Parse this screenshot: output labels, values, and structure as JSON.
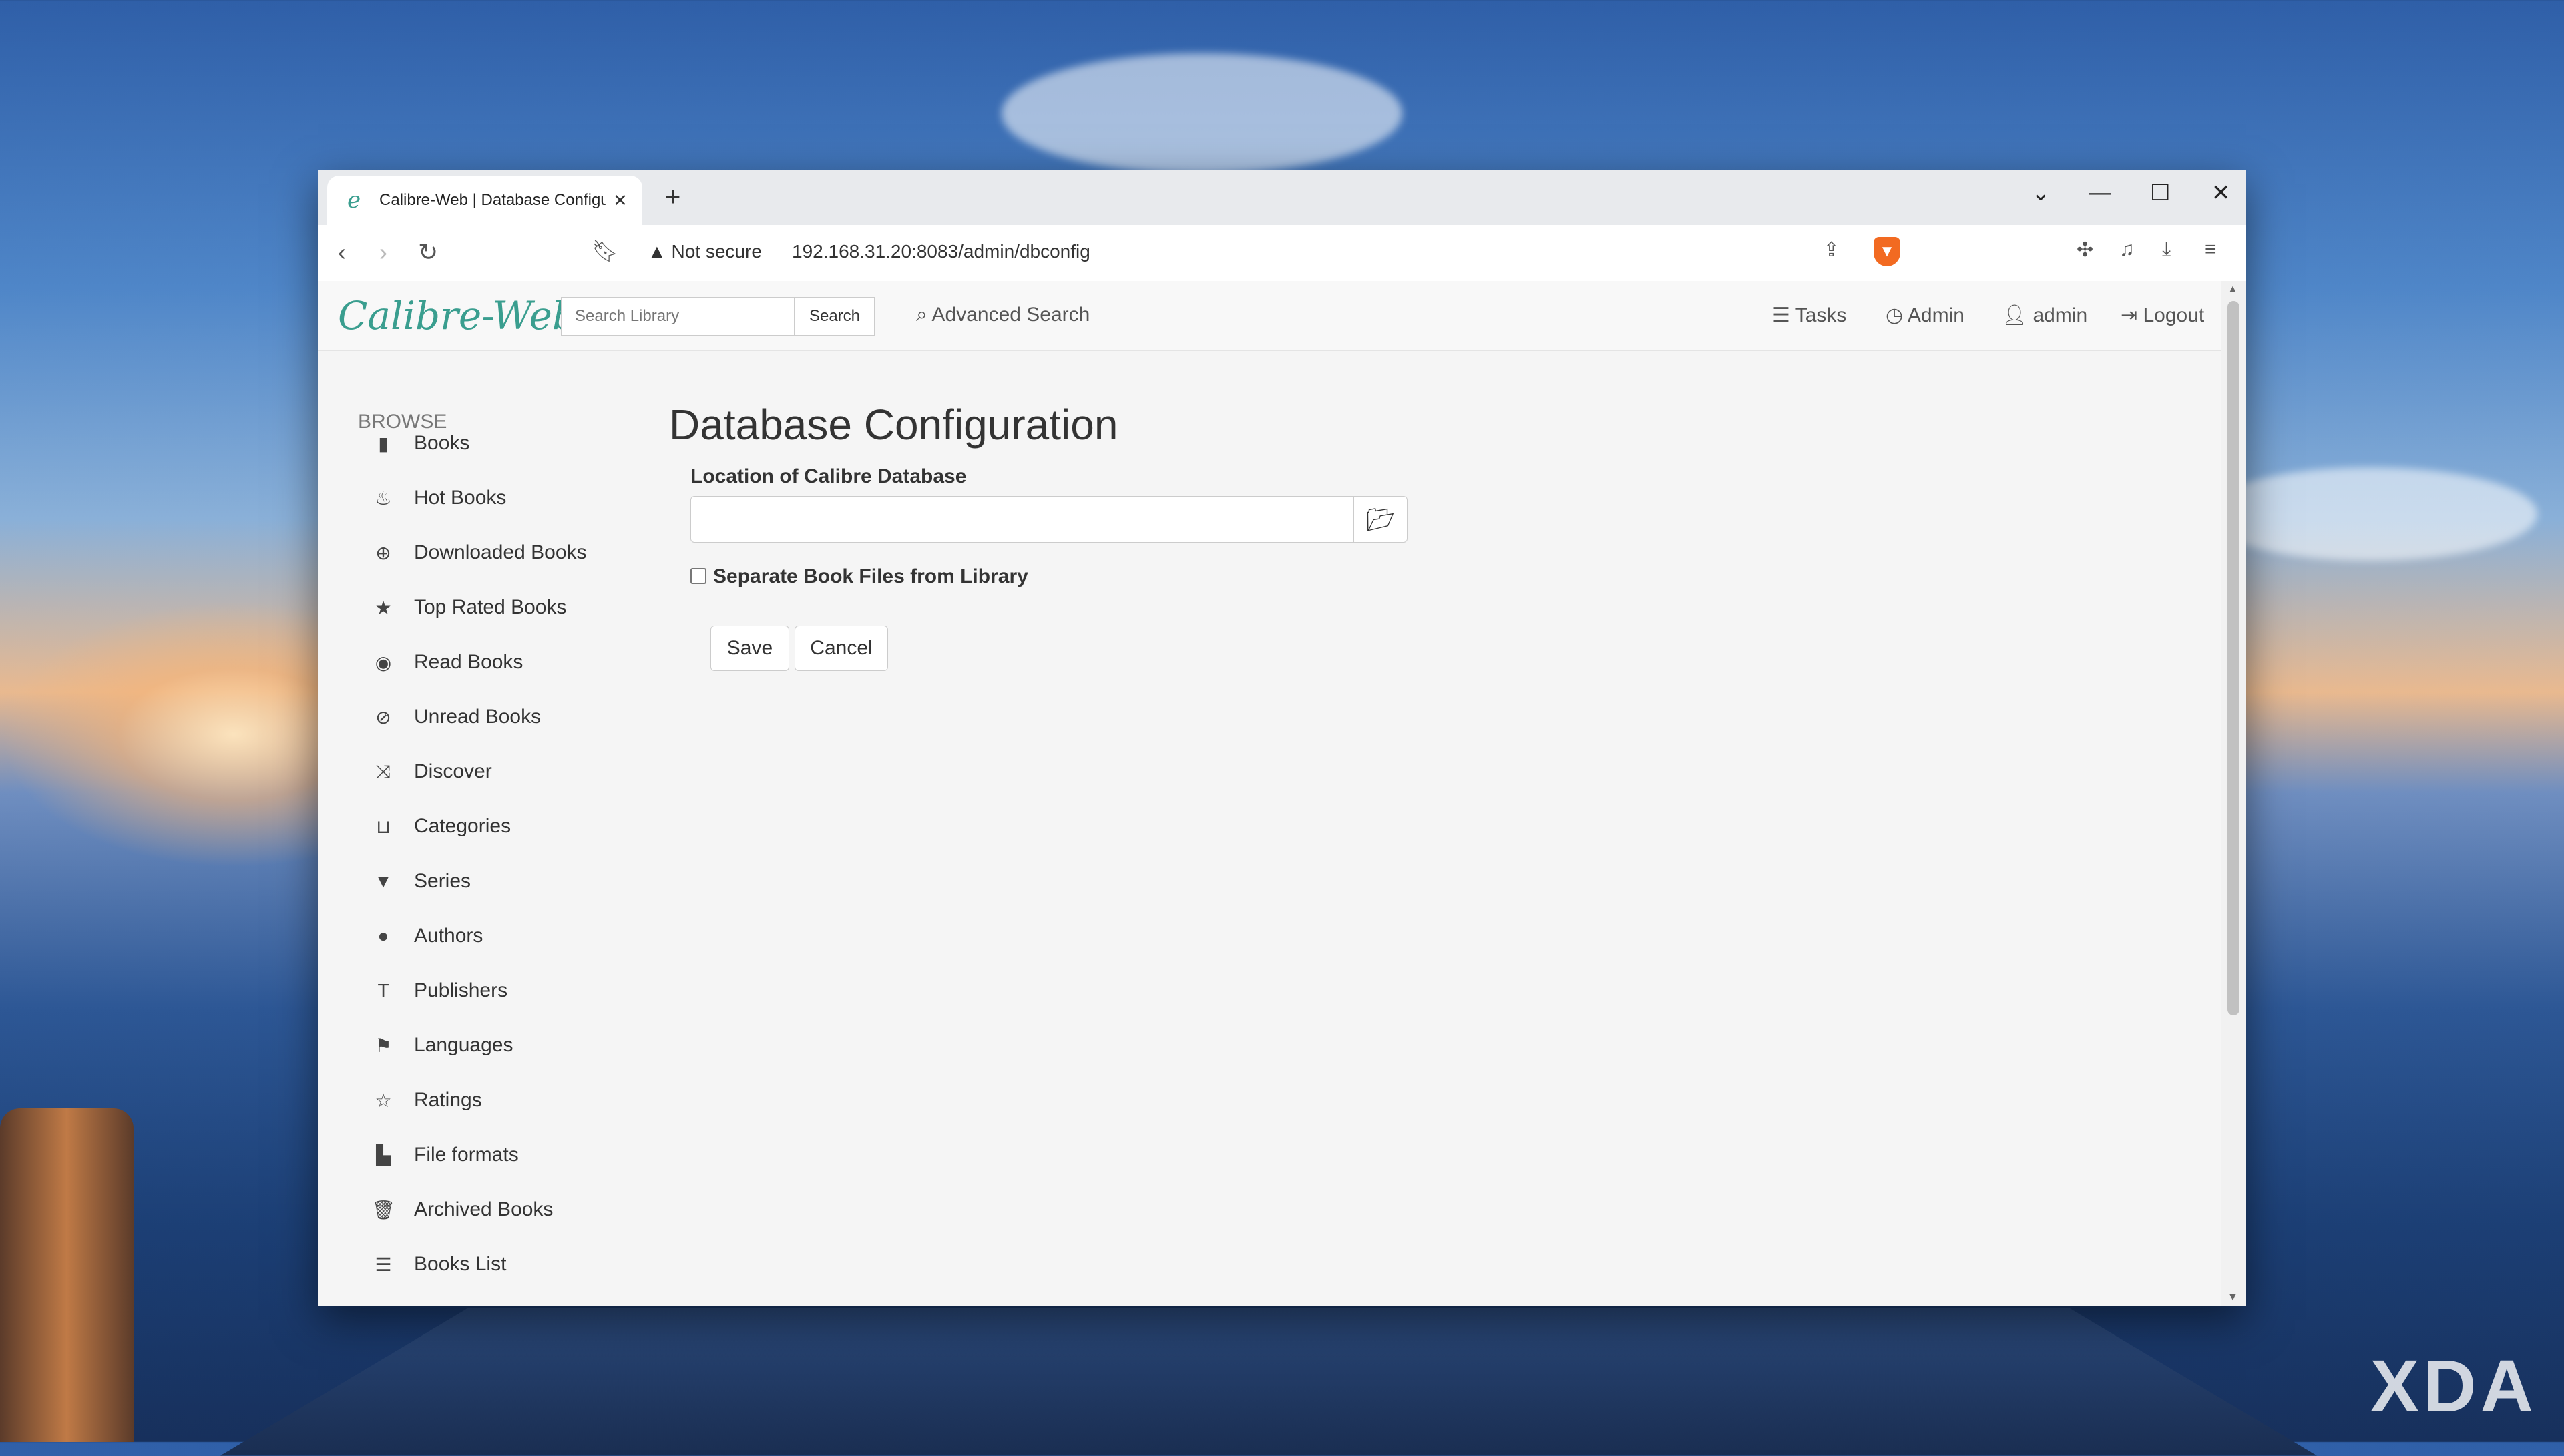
{
  "browser": {
    "tab_title": "Calibre-Web | Database Configuration",
    "favicon_glyph": "e",
    "new_tab_glyph": "+",
    "tab_close_glyph": "✕",
    "security_label": "Not secure",
    "url": "192.168.31.20:8083/admin/dbconfig"
  },
  "navbar": {
    "brand": "Calibre-Web",
    "search_placeholder": "Search Library",
    "search_button": "Search",
    "advanced_search": "Advanced Search",
    "tasks": "Tasks",
    "admin": "Admin",
    "user": "admin",
    "logout": "Logout"
  },
  "sidebar": {
    "heading": "BROWSE",
    "items": [
      {
        "label": "Books",
        "icon": "book-icon"
      },
      {
        "label": "Hot Books",
        "icon": "fire-icon"
      },
      {
        "label": "Downloaded Books",
        "icon": "download-icon"
      },
      {
        "label": "Top Rated Books",
        "icon": "star-icon"
      },
      {
        "label": "Read Books",
        "icon": "eye-icon"
      },
      {
        "label": "Unread Books",
        "icon": "eye-slash-icon"
      },
      {
        "label": "Discover",
        "icon": "random-icon"
      },
      {
        "label": "Categories",
        "icon": "inbox-icon"
      },
      {
        "label": "Series",
        "icon": "bookmark-icon"
      },
      {
        "label": "Authors",
        "icon": "user-icon"
      },
      {
        "label": "Publishers",
        "icon": "text-size-icon"
      },
      {
        "label": "Languages",
        "icon": "flag-icon"
      },
      {
        "label": "Ratings",
        "icon": "star-empty-icon"
      },
      {
        "label": "File formats",
        "icon": "file-icon"
      },
      {
        "label": "Archived Books",
        "icon": "trash-icon"
      },
      {
        "label": "Books List",
        "icon": "list-icon"
      }
    ]
  },
  "main": {
    "title": "Database Configuration",
    "location_label": "Location of Calibre Database",
    "location_value": "",
    "separate_label": "Separate Book Files from Library",
    "separate_checked": false,
    "save_button": "Save",
    "cancel_button": "Cancel"
  },
  "watermark": "XDA"
}
